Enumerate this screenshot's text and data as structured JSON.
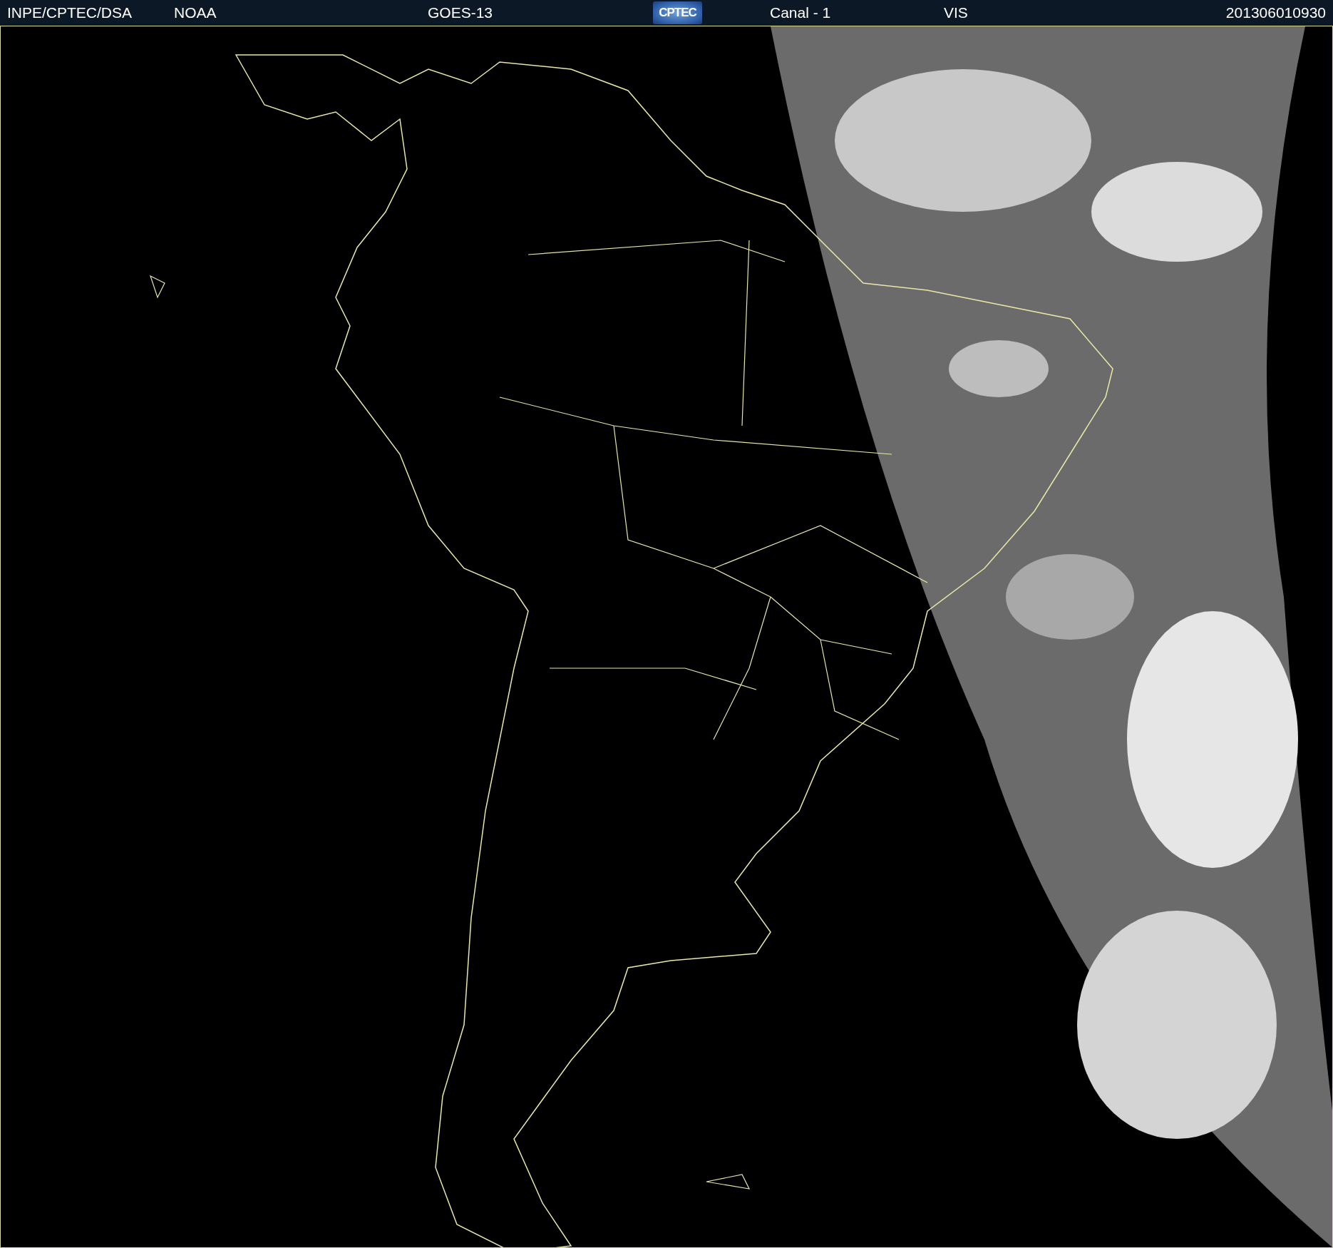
{
  "header": {
    "items": [
      {
        "kind": "text",
        "text": "INPE/CPTEC/DSA"
      },
      {
        "kind": "text",
        "text": "NOAA"
      },
      {
        "kind": "text",
        "text": "GOES-13"
      },
      {
        "kind": "logo",
        "text": "CPTEC"
      },
      {
        "kind": "text",
        "text": "Canal - 1"
      },
      {
        "kind": "text",
        "text": "VIS"
      },
      {
        "kind": "text",
        "text": "201306010930"
      }
    ]
  }
}
